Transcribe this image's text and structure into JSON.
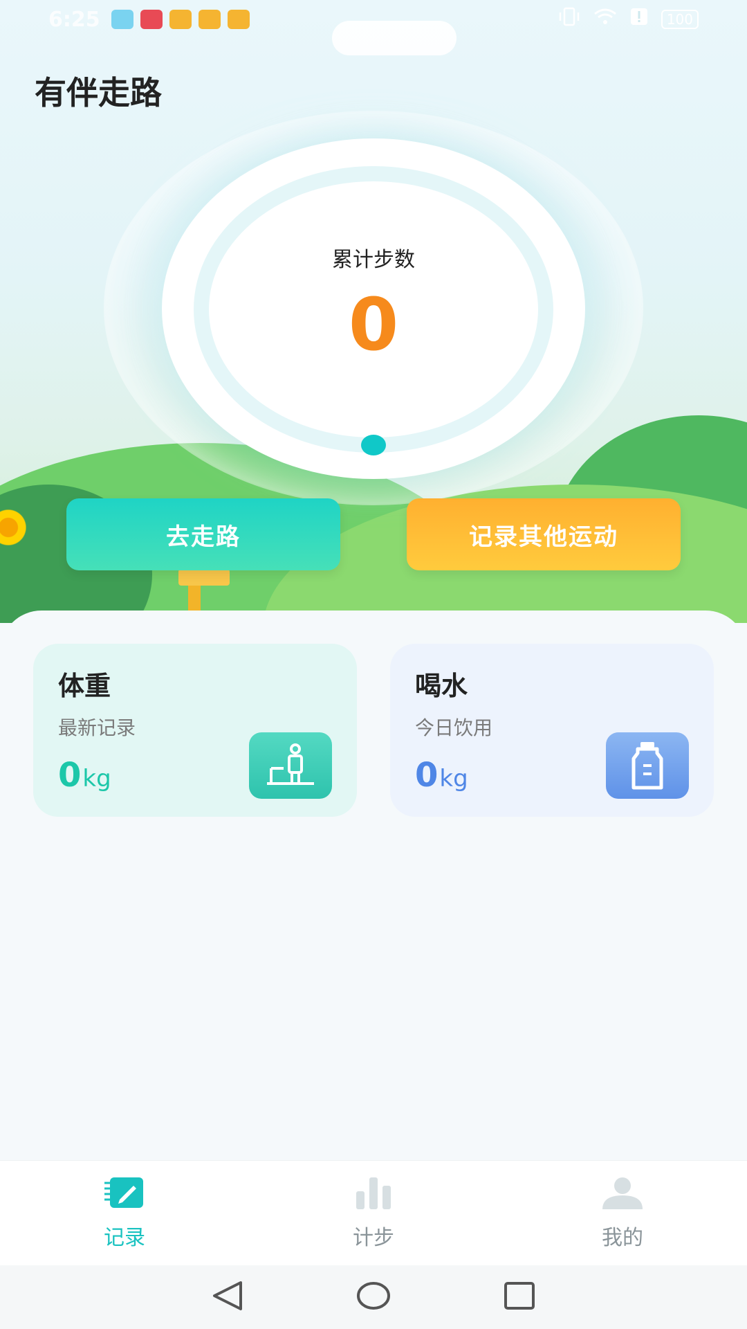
{
  "status_bar": {
    "time": "6:25",
    "battery": "100"
  },
  "app": {
    "title": "有伴走路"
  },
  "steps": {
    "label": "累计步数",
    "value": "0"
  },
  "actions": {
    "walk_label": "去走路",
    "other_label": "记录其他运动"
  },
  "cards": {
    "weight": {
      "title": "体重",
      "subtitle": "最新记录",
      "value": "0",
      "unit": "kg",
      "icon": "scale-person-icon"
    },
    "water": {
      "title": "喝水",
      "subtitle": "今日饮用",
      "value": "0",
      "unit": "kg",
      "icon": "water-bottle-icon"
    }
  },
  "tabs": [
    {
      "label": "记录",
      "icon": "record-icon",
      "active": true
    },
    {
      "label": "计步",
      "icon": "bar-chart-icon",
      "active": false
    },
    {
      "label": "我的",
      "icon": "profile-icon",
      "active": false
    }
  ],
  "colors": {
    "accent": "#19c2c0",
    "steps_value": "#f68a1c",
    "walk_button": "#1fd4c5",
    "other_button": "#ffb030",
    "weight_value": "#1cc7a9",
    "water_value": "#4f86e6"
  }
}
